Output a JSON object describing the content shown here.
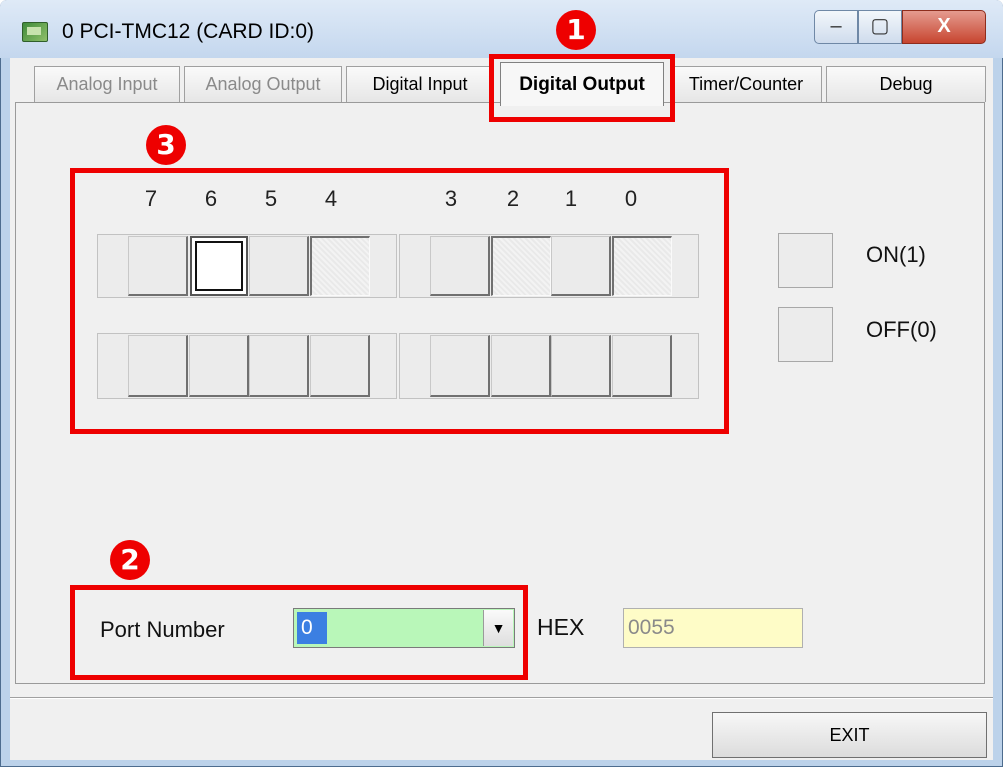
{
  "window": {
    "title": "0 PCI-TMC12 (CARD ID:0)",
    "controls": {
      "minimize": "–",
      "maximize": "▢",
      "close": "X"
    }
  },
  "tabs": [
    {
      "label": "Analog Input",
      "state": "disabled"
    },
    {
      "label": "Analog Output",
      "state": "disabled"
    },
    {
      "label": "Digital Input",
      "state": "normal"
    },
    {
      "label": "Digital Output",
      "state": "selected"
    },
    {
      "label": "Timer/Counter",
      "state": "normal"
    },
    {
      "label": "Debug",
      "state": "normal"
    }
  ],
  "bits": {
    "labels": [
      "7",
      "6",
      "5",
      "4",
      "3",
      "2",
      "1",
      "0"
    ],
    "output_row": [
      "OFF",
      "ON",
      "OFF",
      "ON",
      "OFF",
      "ON",
      "OFF",
      "ON"
    ]
  },
  "legend": {
    "on_label": "ON(1)",
    "off_label": "OFF(0)"
  },
  "port": {
    "label": "Port Number",
    "value": "0",
    "bg_color": "#b9f7b9"
  },
  "hex": {
    "label": "HEX",
    "value": "0055",
    "bg_color": "#fefcc7"
  },
  "exit_label": "EXIT",
  "annotations": {
    "marker_1": "1",
    "marker_2": "2",
    "marker_3": "3",
    "color": "#ee0000"
  }
}
